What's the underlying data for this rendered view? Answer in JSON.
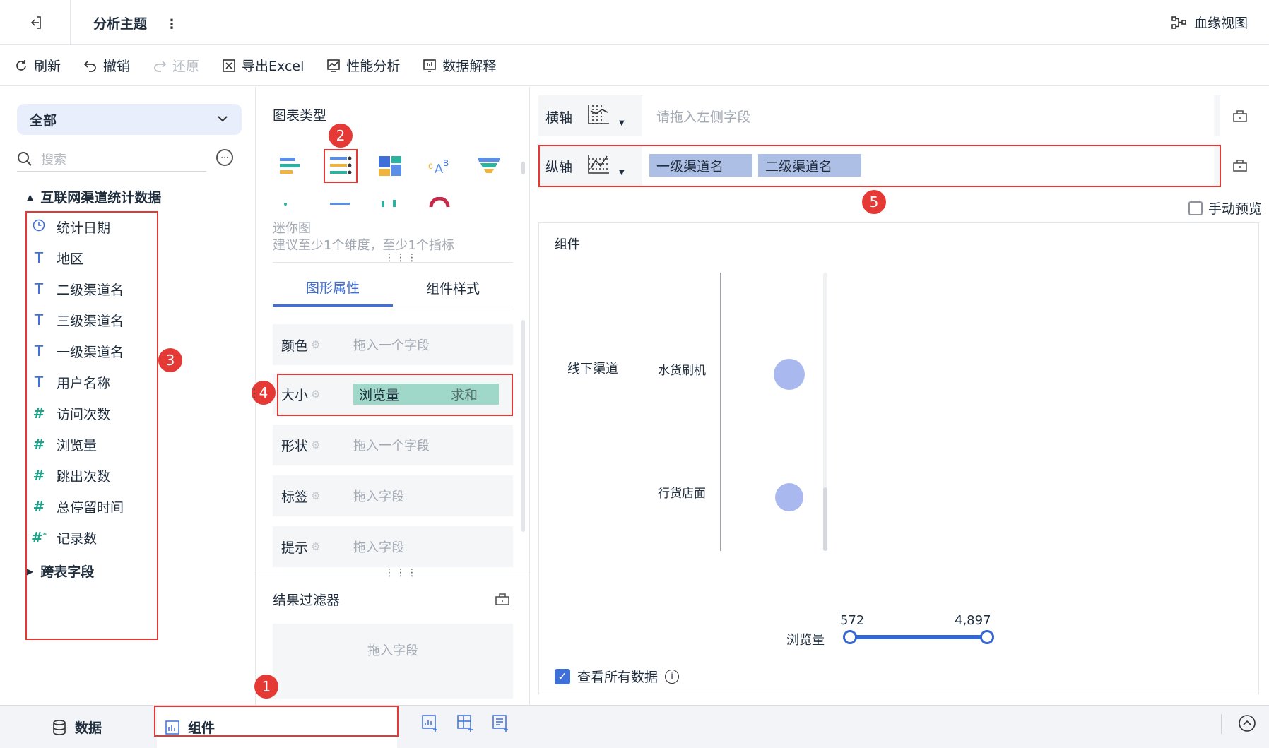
{
  "header": {
    "title": "分析主题",
    "more": "⋮",
    "lineage": "血缘视图"
  },
  "toolbar": {
    "refresh": "刷新",
    "undo": "撤销",
    "redo": "还原",
    "export": "导出Excel",
    "perf": "性能分析",
    "explain": "数据解释"
  },
  "left": {
    "scope": "全部",
    "search_placeholder": "搜索",
    "dataset": "互联网渠道统计数据",
    "fields": [
      {
        "name": "统计日期",
        "type": "date"
      },
      {
        "name": "地区",
        "type": "text"
      },
      {
        "name": "二级渠道名",
        "type": "text"
      },
      {
        "name": "三级渠道名",
        "type": "text"
      },
      {
        "name": "一级渠道名",
        "type": "text"
      },
      {
        "name": "用户名称",
        "type": "text"
      },
      {
        "name": "访问次数",
        "type": "number"
      },
      {
        "name": "浏览量",
        "type": "number"
      },
      {
        "name": "跳出次数",
        "type": "number"
      },
      {
        "name": "总停留时间",
        "type": "number"
      },
      {
        "name": "记录数",
        "type": "number-calc"
      }
    ],
    "cross_table": "跨表字段"
  },
  "middle": {
    "chart_type_title": "图表类型",
    "hint_name": "迷你图",
    "hint_text": "建议至少1个维度，至少1个指标",
    "tabs": [
      "图形属性",
      "组件样式"
    ],
    "props": [
      {
        "label": "颜色",
        "placeholder": "拖入一个字段"
      },
      {
        "label": "大小",
        "field": "浏览量",
        "agg": "求和"
      },
      {
        "label": "形状",
        "placeholder": "拖入一个字段"
      },
      {
        "label": "标签",
        "placeholder": "拖入字段"
      },
      {
        "label": "提示",
        "placeholder": "拖入字段"
      }
    ],
    "filter_title": "结果过滤器",
    "filter_placeholder": "拖入字段"
  },
  "right": {
    "x_axis": {
      "label": "横轴",
      "placeholder": "请拖入左侧字段"
    },
    "y_axis": {
      "label": "纵轴",
      "fields": [
        "一级渠道名",
        "二级渠道名"
      ]
    },
    "manual_preview": "手动预览",
    "component_title": "组件",
    "view_all": "查看所有数据"
  },
  "chart_data": {
    "type": "scatter",
    "rows": [
      {
        "level1": "线下渠道",
        "level2": "水货刷机",
        "size_rel": 1.0
      },
      {
        "level1": "线下渠道",
        "level2": "行货店面",
        "size_rel": 0.9
      }
    ],
    "legend": {
      "field": "浏览量",
      "min": "572",
      "max": "4,897"
    }
  },
  "bottom": {
    "data_tab": "数据",
    "component_tab": "组件"
  },
  "badges": [
    "1",
    "2",
    "3",
    "4",
    "5"
  ],
  "colors": {
    "accent": "#3f6fd9",
    "highlight": "#e53935",
    "measure_pill": "#9fd7c8",
    "dimension_pill": "#aebfe6",
    "bubble": "#a9b9f0"
  }
}
